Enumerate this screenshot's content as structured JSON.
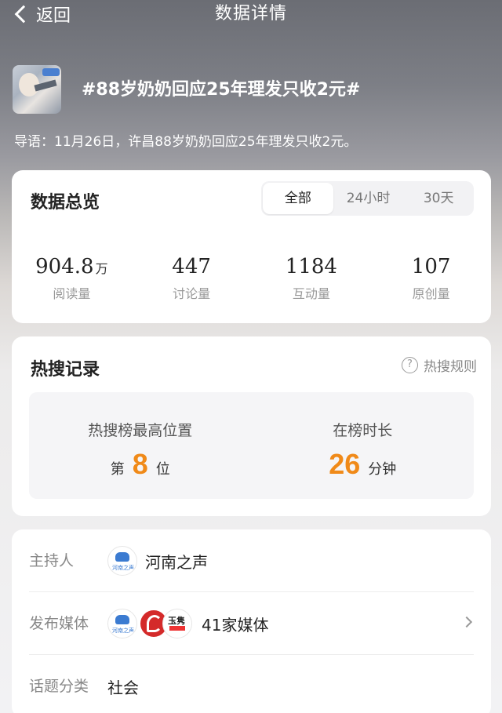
{
  "nav": {
    "back_label": "返回",
    "title": "数据详情"
  },
  "topic": {
    "title": "#88岁奶奶回应25年理发只收2元#",
    "lead": "导语：11月26日，许昌88岁奶奶回应25年理发只收2元。"
  },
  "overview": {
    "title": "数据总览",
    "tabs": [
      "全部",
      "24小时",
      "30天"
    ],
    "selected_tab": "全部",
    "stats": [
      {
        "value": "904.8",
        "unit": "万",
        "label": "阅读量"
      },
      {
        "value": "447",
        "unit": "",
        "label": "讨论量"
      },
      {
        "value": "1184",
        "unit": "",
        "label": "互动量"
      },
      {
        "value": "107",
        "unit": "",
        "label": "原创量"
      }
    ]
  },
  "hot_search": {
    "title": "热搜记录",
    "rule_label": "热搜规则",
    "rule_icon": "?",
    "highest": {
      "label": "热搜榜最高位置",
      "prefix": "第",
      "value": "8",
      "suffix": "位"
    },
    "duration": {
      "label": "在榜时长",
      "value": "26",
      "suffix": "分钟"
    },
    "accent_color": "#f08a19"
  },
  "info": {
    "host_label": "主持人",
    "host_name": "河南之声",
    "host_logo_text": "河南之声",
    "media_label": "发布媒体",
    "media_count": "41家媒体",
    "media_logo2_text": "玉隽",
    "category_label": "话题分类",
    "category_value": "社会"
  }
}
